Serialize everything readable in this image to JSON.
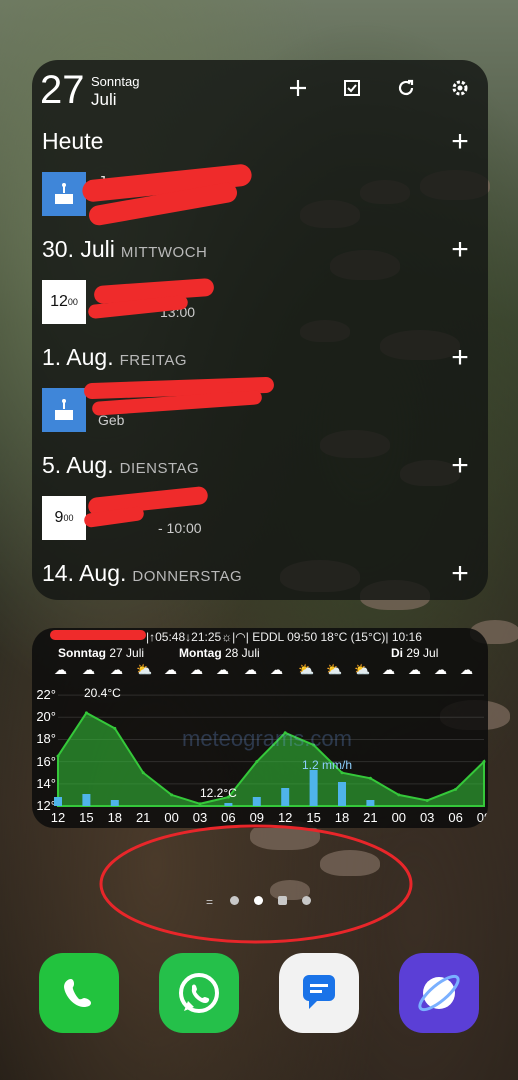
{
  "calendar": {
    "day_number": "27",
    "weekday": "Sonntag",
    "month": "Juli",
    "days": [
      {
        "heading": "Heute",
        "weekday": "",
        "event": {
          "type": "birthday",
          "time": "",
          "title": "J",
          "subtitle": ""
        }
      },
      {
        "heading": "30. Juli",
        "weekday": "MITTWOCH",
        "event": {
          "type": "timed",
          "time": "12",
          "time_sup": "00",
          "title": "",
          "subtitle": "13:00"
        }
      },
      {
        "heading": "1. Aug.",
        "weekday": "FREITAG",
        "event": {
          "type": "birthday",
          "time": "",
          "title": "",
          "subtitle": "Geb"
        }
      },
      {
        "heading": "5. Aug.",
        "weekday": "DIENSTAG",
        "event": {
          "type": "timed",
          "time": "9",
          "time_sup": "00",
          "title": "",
          "subtitle": "- 10:00"
        }
      },
      {
        "heading": "14. Aug.",
        "weekday": "DONNERSTAG",
        "event": null
      }
    ],
    "icons": [
      "plus-icon",
      "checkbox-icon",
      "refresh-icon",
      "settings-icon"
    ]
  },
  "weather": {
    "status_line": "|↑05:48↓21:25☼|◠| EDDL 09:50 18°C (15°C)| 10:16",
    "day_labels": [
      {
        "bold": "Sonntag",
        "rest": " 27 Juli"
      },
      {
        "bold": "Montag",
        "rest": " 28 Juli"
      },
      {
        "bold": "Di",
        "rest": " 29 Jul"
      }
    ],
    "max_temp_label": "20.4°C",
    "min_temp_label": "12.2°C",
    "precip_label": "1.2 mm/h",
    "watermark": "meteograms.com",
    "colors": {
      "temp": "#35c83a",
      "precip": "#4fb4ea",
      "grey": "#a0a0a0"
    }
  },
  "chart_data": {
    "type": "area",
    "title": "",
    "xlabel": "",
    "ylabel": "",
    "x": [
      "12",
      "15",
      "18",
      "21",
      "00",
      "03",
      "06",
      "09",
      "12",
      "15",
      "18",
      "21",
      "00",
      "03",
      "06",
      "09"
    ],
    "y_ticks": [
      "22°",
      "20°",
      "18°",
      "16°",
      "14°",
      "12°"
    ],
    "ylim": [
      12,
      23
    ],
    "series": [
      {
        "values": [
          16.5,
          20.4,
          19.0,
          15.0,
          13.0,
          12.2,
          12.8,
          16.0,
          18.6,
          17.5,
          15.0,
          14.5,
          13.0,
          12.5,
          13.5,
          16.0
        ]
      }
    ]
  },
  "pager": {
    "count": 4,
    "active": 1
  },
  "dock": [
    {
      "name": "phone-app",
      "color": "#2ecc40"
    },
    {
      "name": "whatsapp-app",
      "color": "#25c04a"
    },
    {
      "name": "messages-app",
      "color": "#f2f2f2"
    },
    {
      "name": "internet-app",
      "color": "#5b3fd6"
    }
  ]
}
